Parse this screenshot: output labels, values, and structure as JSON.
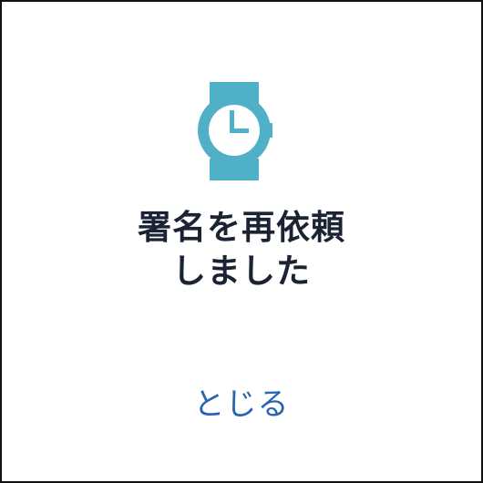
{
  "dialog": {
    "icon": "watch-icon",
    "title_line1": "署名を再依頼",
    "title_line2": "しました",
    "close_label": "とじる"
  },
  "colors": {
    "icon": "#4fb0c8",
    "title": "#1b2233",
    "link": "#2a63b0",
    "border": "#111111"
  }
}
